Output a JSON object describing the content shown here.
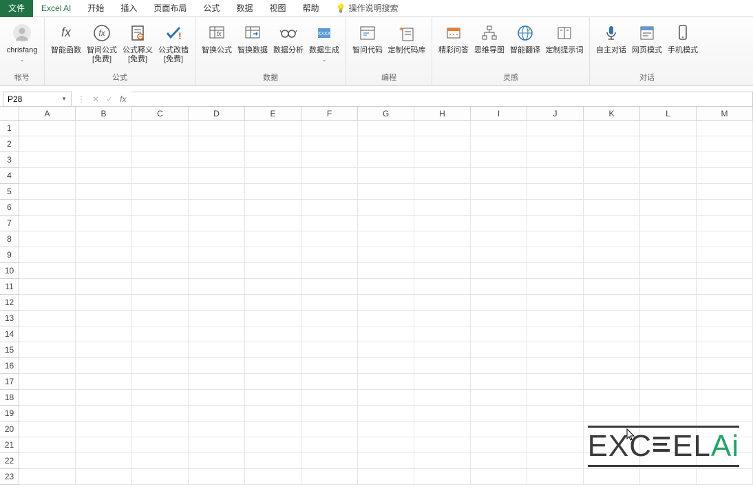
{
  "tabs": {
    "file": "文件",
    "ai": "Excel AI",
    "start": "开始",
    "insert": "插入",
    "layout": "页面布局",
    "formula": "公式",
    "data": "数据",
    "view": "视图",
    "help": "帮助",
    "tell": "操作说明搜索"
  },
  "account": {
    "name": "chrisfang",
    "group": "帐号"
  },
  "groups": {
    "fx": {
      "label": "公式",
      "btn_smart": "智能函数",
      "btn_ask": "智问公式\n[免费]",
      "btn_explain": "公式释义\n[免费]",
      "btn_fix": "公式改错\n[免费]"
    },
    "data": {
      "label": "数据",
      "btn_swap_fx": "智换公式",
      "btn_swap_data": "智换数据",
      "btn_analyze": "数据分析",
      "btn_gen": "数据生成"
    },
    "code": {
      "label": "编程",
      "btn_ask": "智问代码",
      "btn_lib": "定制代码库"
    },
    "inspire": {
      "label": "灵感",
      "btn_qa": "精彩问答",
      "btn_mind": "思维导图",
      "btn_trans": "智能翻译",
      "btn_prompt": "定制提示词"
    },
    "dialog": {
      "label": "对话",
      "btn_self": "自主对话",
      "btn_web": "网页模式",
      "btn_mobile": "手机模式"
    }
  },
  "namebox": "P28",
  "formula_value": "",
  "columns": [
    "A",
    "B",
    "C",
    "D",
    "E",
    "F",
    "G",
    "H",
    "I",
    "J",
    "K",
    "L",
    "M"
  ],
  "rows": [
    "1",
    "2",
    "3",
    "4",
    "5",
    "6",
    "7",
    "8",
    "9",
    "10",
    "11",
    "12",
    "13",
    "14",
    "15",
    "16",
    "17",
    "18",
    "19",
    "20",
    "21",
    "22",
    "23"
  ],
  "logo": {
    "p1": "EXC",
    "p2": "EL",
    "p3": "Ai"
  }
}
